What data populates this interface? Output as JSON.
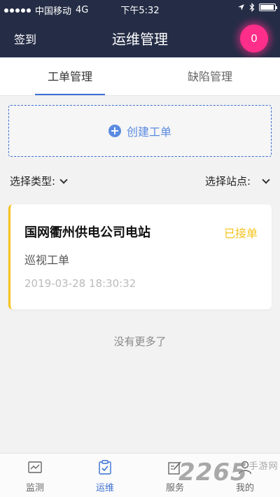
{
  "status_bar": {
    "carrier": "中国移动",
    "network": "4G",
    "time": "下午5:32"
  },
  "nav": {
    "left_action": "签到",
    "title": "运维管理",
    "badge_count": "0",
    "badge_color": "#ff2e8a"
  },
  "tabs": [
    {
      "label": "工单管理",
      "active": true
    },
    {
      "label": "缺陷管理",
      "active": false
    }
  ],
  "create_button": {
    "label": "创建工单",
    "icon": "plus-circle-icon"
  },
  "filters": {
    "type_label": "选择类型:",
    "site_label": "选择站点:"
  },
  "work_orders": [
    {
      "title": "国网衢州供电公司电站",
      "status": "已接单",
      "type": "巡视工单",
      "timestamp": "2019-03-28 18:30:32"
    }
  ],
  "list_end_text": "没有更多了",
  "bottom_nav": [
    {
      "label": "监测",
      "icon": "chart-icon",
      "active": false
    },
    {
      "label": "运维",
      "icon": "clipboard-check-icon",
      "active": true
    },
    {
      "label": "服务",
      "icon": "edit-icon",
      "active": false
    },
    {
      "label": "我的",
      "icon": "user-icon",
      "active": false
    }
  ],
  "watermark": {
    "text": "2265",
    "suffix": "手游网"
  },
  "colors": {
    "header_bg": "#252d46",
    "accent": "#3b6fd4",
    "status_pending": "#f3c31d"
  }
}
